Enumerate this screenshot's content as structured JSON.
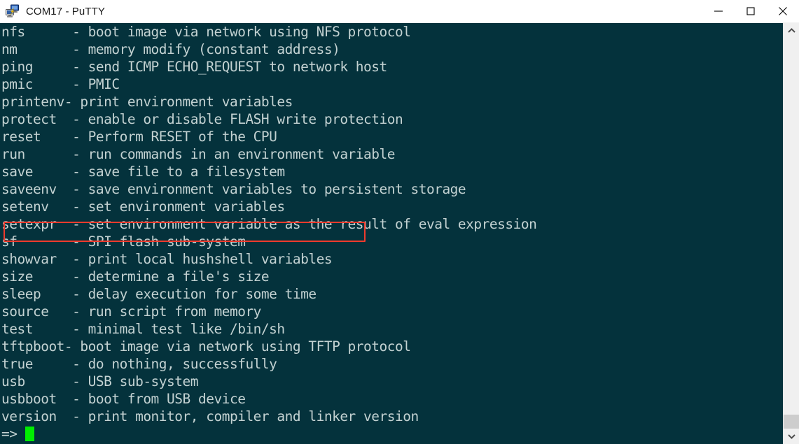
{
  "window": {
    "title": "COM17 - PuTTY",
    "icon": "putty-network-icon",
    "controls": {
      "minimize": "minimize-icon",
      "maximize": "maximize-icon",
      "close": "close-icon"
    }
  },
  "theme": {
    "terminal_background": "#04323c",
    "terminal_foreground": "#c3d2d2",
    "cursor_color": "#00ee00",
    "annotation_color": "#ef3b2d",
    "titlebar_background": "#ffffff",
    "titlebar_foreground": "#1a1a1a",
    "scrollbar_track": "#f0f0f0",
    "scrollbar_thumb": "#cdcdcd"
  },
  "terminal": {
    "lines": [
      "nfs      - boot image via network using NFS protocol",
      "nm       - memory modify (constant address)",
      "ping     - send ICMP ECHO_REQUEST to network host",
      "pmic     - PMIC",
      "printenv- print environment variables",
      "protect  - enable or disable FLASH write protection",
      "reset    - Perform RESET of the CPU",
      "run      - run commands in an environment variable",
      "save     - save file to a filesystem",
      "saveenv  - save environment variables to persistent storage",
      "setenv   - set environment variables",
      "setexpr  - set environment variable as the result of eval expression",
      "sf       - SPI flash sub-system",
      "showvar  - print local hushshell variables",
      "size     - determine a file's size",
      "sleep    - delay execution for some time",
      "source   - run script from memory",
      "test     - minimal test like /bin/sh",
      "tftpboot- boot image via network using TFTP protocol",
      "true     - do nothing, successfully",
      "usb      - USB sub-system",
      "usbboot  - boot from USB device",
      "version  - print monitor, compiler and linker version"
    ],
    "prompt": "=> ",
    "prompt_input": "",
    "highlighted_line_index": 10,
    "highlighted_line_text": "setenv   - set environment variables"
  },
  "scrollbar": {
    "up_arrow": "chevron-up-icon",
    "down_arrow": "chevron-down-icon",
    "thumb_position": "bottom"
  }
}
